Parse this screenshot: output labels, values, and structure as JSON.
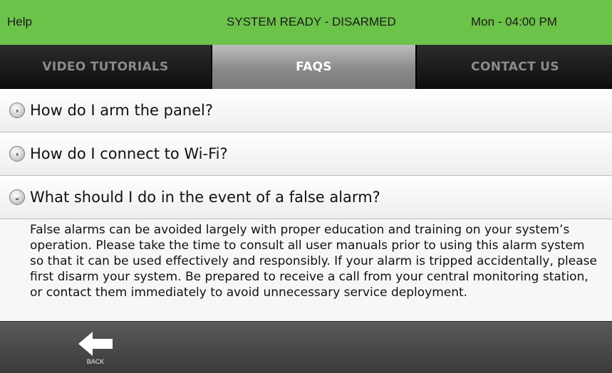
{
  "status": {
    "help": "Help",
    "state": "SYSTEM READY - DISARMED",
    "time": "Mon - 04:00 PM"
  },
  "tabs": [
    {
      "label": "VIDEO TUTORIALS"
    },
    {
      "label": "FAQS"
    },
    {
      "label": "CONTACT US"
    }
  ],
  "active_tab": "FAQS",
  "faqs": [
    {
      "question": "How do I arm the panel?",
      "icon": "chevron-right-icon"
    },
    {
      "question": "How do I connect to Wi-Fi?",
      "icon": "chevron-right-icon"
    },
    {
      "question": "What should I do in the event of a false alarm?",
      "icon": "chevron-down-icon"
    }
  ],
  "answer": "False alarms can be avoided largely with proper education and training on your system’s operation. Please take the time to consult all user manuals prior to using this alarm system so that it can be used effectively and responsibly. If your alarm is tripped accidentally, please first disarm your system. Be prepared to receive a call from your central monitoring station, or contact them immediately to avoid unnecessary service deployment.",
  "bottom": {
    "back_label": "BACK",
    "back_icon": "arrow-left-icon"
  },
  "colors": {
    "status_bar": "#6cc34a",
    "active_tab": "#9a9a9a",
    "inactive_tab": "#1c1c1c",
    "bottom_bar": "#4a4a4a"
  }
}
